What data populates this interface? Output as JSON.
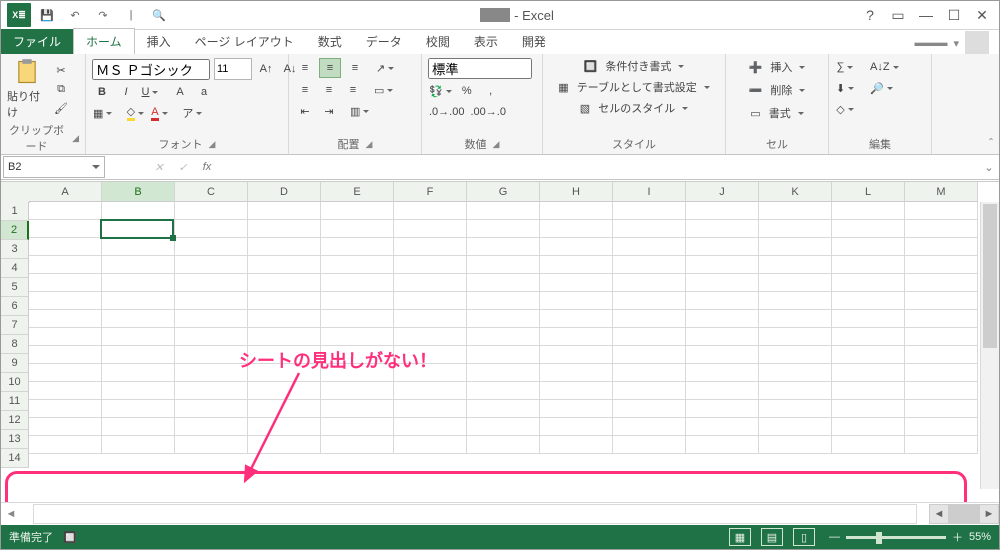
{
  "title": {
    "app_suffix": " - Excel",
    "doc_obscured": true
  },
  "qat": {
    "save": "💾",
    "undo": "↶",
    "redo": "↷",
    "pp": "🔍"
  },
  "help": "?",
  "ribbon_display": "▭",
  "account": {
    "name_masked": "▬▬▬",
    "dropdown": "▾"
  },
  "tabs": {
    "file": "ファイル",
    "home": "ホーム",
    "insert": "挿入",
    "page_layout": "ページ レイアウト",
    "formulas": "数式",
    "data": "データ",
    "review": "校閲",
    "view": "表示",
    "developer": "開発"
  },
  "groups": {
    "clipboard": {
      "label": "クリップボード",
      "paste": "貼り付け"
    },
    "font": {
      "label": "フォント",
      "name": "ＭＳ Ｐゴシック",
      "size": "11",
      "bold": "B",
      "italic": "I",
      "underline": "U"
    },
    "alignment": {
      "label": "配置"
    },
    "number": {
      "label": "数値",
      "format": "標準"
    },
    "styles": {
      "label": "スタイル",
      "cond": "条件付き書式",
      "table": "テーブルとして書式設定",
      "cell": "セルのスタイル"
    },
    "cells": {
      "label": "セル",
      "insert": "挿入",
      "delete": "削除",
      "format": "書式"
    },
    "editing": {
      "label": "編集"
    }
  },
  "formula_bar": {
    "name_box": "B2",
    "fx": "fx",
    "value": ""
  },
  "grid": {
    "columns": [
      "A",
      "B",
      "C",
      "D",
      "E",
      "F",
      "G",
      "H",
      "I",
      "J",
      "K",
      "L",
      "M"
    ],
    "rows": [
      "1",
      "2",
      "3",
      "4",
      "5",
      "6",
      "7",
      "8",
      "9",
      "10",
      "11",
      "12",
      "13",
      "14"
    ],
    "selected_col": "B",
    "selected_row": "2"
  },
  "annotation": {
    "text": "シートの見出しがない！"
  },
  "status": {
    "ready": "準備完了",
    "zoom": "55%"
  }
}
